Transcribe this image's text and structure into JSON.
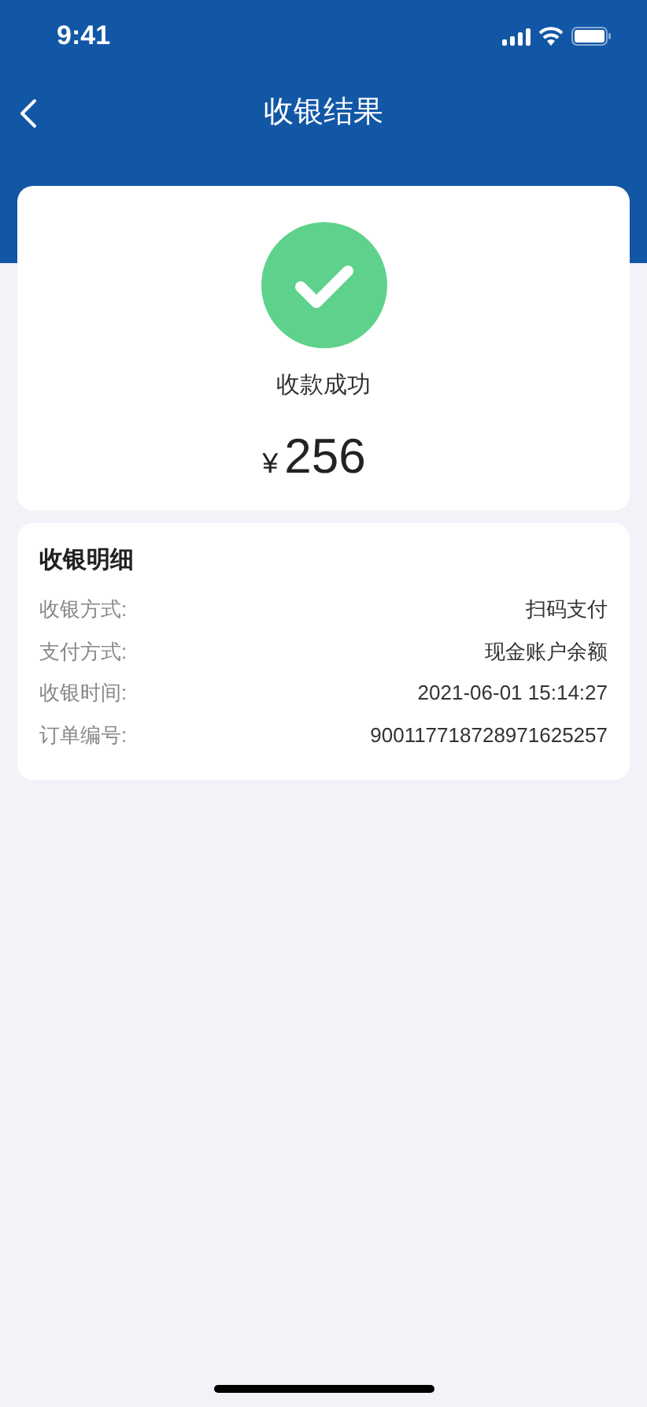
{
  "status_bar": {
    "time": "9:41"
  },
  "nav": {
    "title": "收银结果"
  },
  "result": {
    "message": "收款成功",
    "currency": "¥",
    "amount": "256"
  },
  "details": {
    "title": "收银明细",
    "rows": [
      {
        "label": "收银方式:",
        "value": "扫码支付"
      },
      {
        "label": "支付方式:",
        "value": "现金账户余额"
      },
      {
        "label": "收银时间:",
        "value": "2021-06-01 15:14:27"
      },
      {
        "label": "订单编号:",
        "value": "900117718728971625257"
      }
    ]
  }
}
